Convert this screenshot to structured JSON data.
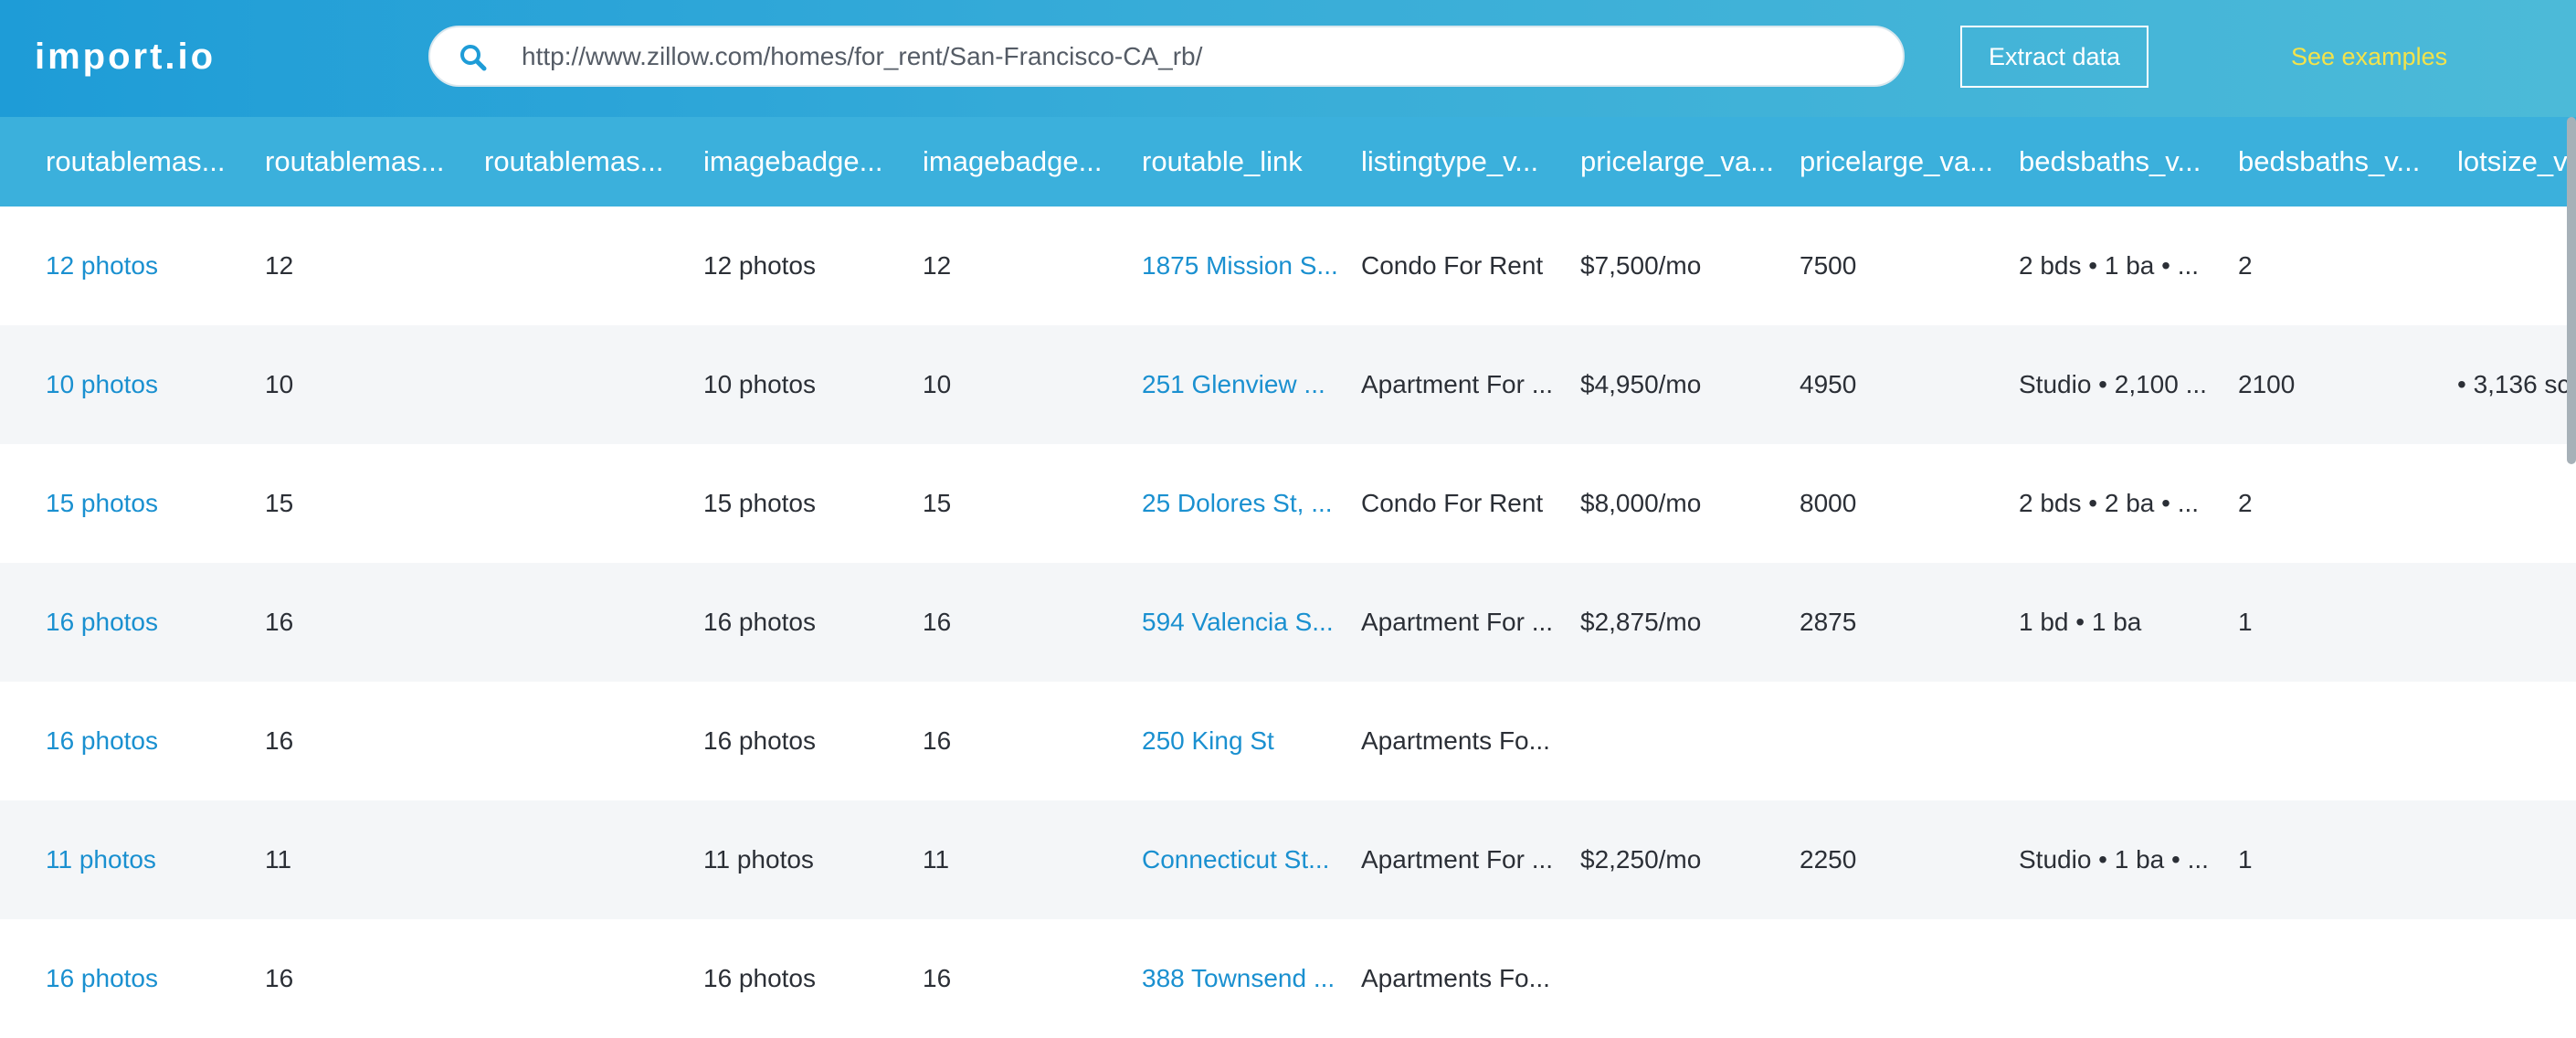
{
  "header": {
    "logo": "import.io",
    "url": "http://www.zillow.com/homes/for_rent/San-Francisco-CA_rb/",
    "extract_label": "Extract data",
    "examples_label": "See examples"
  },
  "table": {
    "columns": [
      "routablemas...",
      "routablemas...",
      "routablemas...",
      "imagebadge...",
      "imagebadge...",
      "routable_link",
      "listingtype_v...",
      "pricelarge_va...",
      "pricelarge_va...",
      "bedsbaths_v...",
      "bedsbaths_v...",
      "lotsize_v"
    ],
    "rows": [
      [
        "12 photos",
        "12",
        "",
        "12 photos",
        "12",
        "1875 Mission S...",
        "Condo For Rent",
        "$7,500/mo",
        "7500",
        "2 bds • 1 ba • ...",
        "2",
        ""
      ],
      [
        "10 photos",
        "10",
        "",
        "10 photos",
        "10",
        "251 Glenview ...",
        "Apartment For ...",
        "$4,950/mo",
        "4950",
        "Studio • 2,100 ...",
        "2100",
        "• 3,136 sc"
      ],
      [
        "15 photos",
        "15",
        "",
        "15 photos",
        "15",
        "25 Dolores St, ...",
        "Condo For Rent",
        "$8,000/mo",
        "8000",
        "2 bds • 2 ba • ...",
        "2",
        ""
      ],
      [
        "16 photos",
        "16",
        "",
        "16 photos",
        "16",
        "594 Valencia S...",
        "Apartment For ...",
        "$2,875/mo",
        "2875",
        "1 bd • 1 ba",
        "1",
        ""
      ],
      [
        "16 photos",
        "16",
        "",
        "16 photos",
        "16",
        "250 King St",
        "Apartments Fo...",
        "",
        "",
        "",
        "",
        ""
      ],
      [
        "11 photos",
        "11",
        "",
        "11 photos",
        "11",
        "Connecticut St...",
        "Apartment For ...",
        "$2,250/mo",
        "2250",
        "Studio • 1 ba • ...",
        "1",
        ""
      ],
      [
        "16 photos",
        "16",
        "",
        "16 photos",
        "16",
        "388 Townsend ...",
        "Apartments Fo...",
        "",
        "",
        "",
        "",
        ""
      ]
    ]
  },
  "colors": {
    "header_bg": "#3bb0dc",
    "link": "#1a90d0",
    "examples": "#f4e34a",
    "alt_row": "#f4f6f8"
  },
  "icons": {
    "search": "search-icon"
  }
}
